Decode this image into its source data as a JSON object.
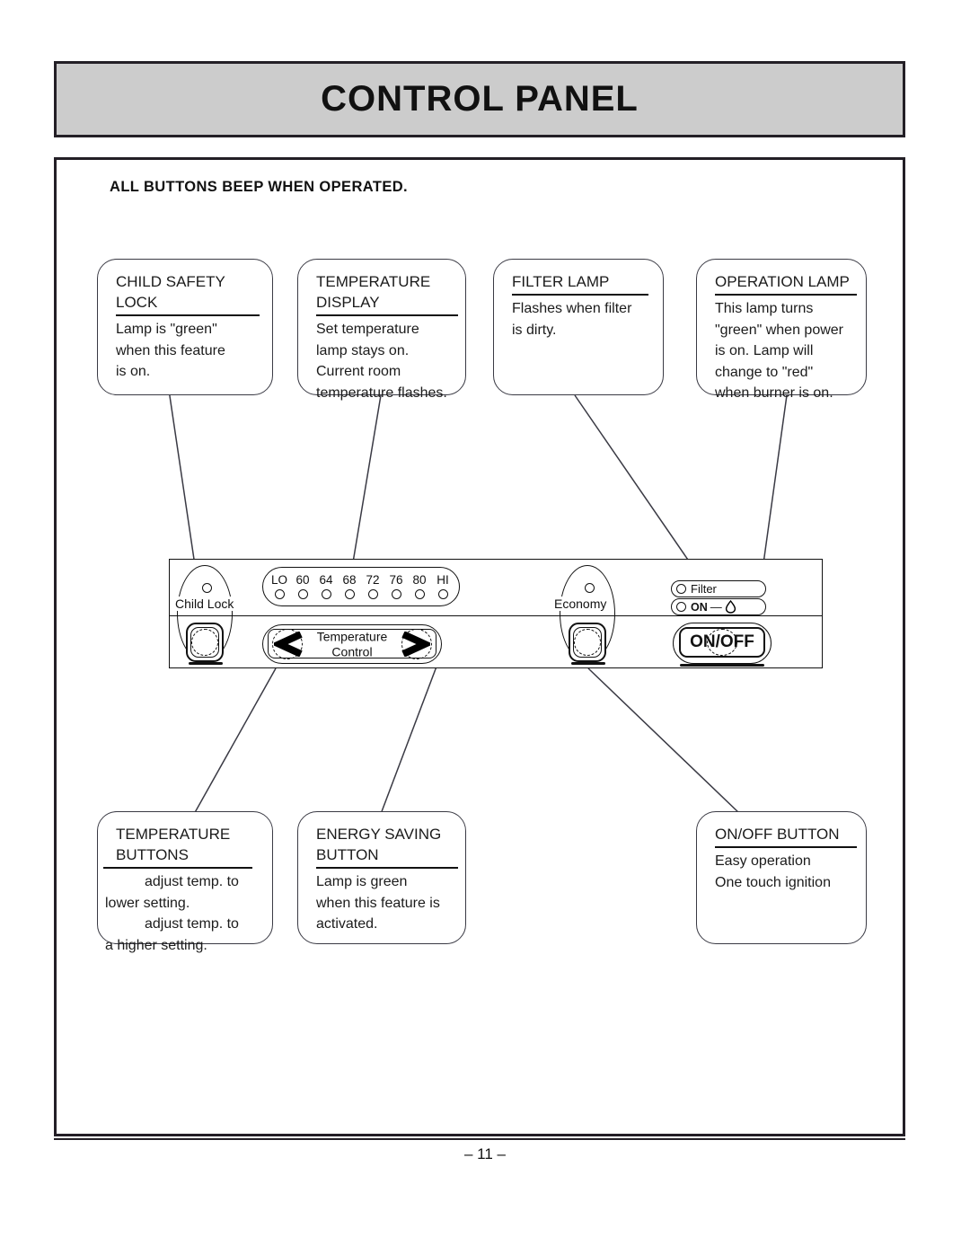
{
  "header": {
    "title": "CONTROL PANEL"
  },
  "notice": "ALL BUTTONS BEEP WHEN OPERATED.",
  "callouts": {
    "child_safety_lock": {
      "title_line1": "CHILD SAFETY",
      "title_line2": "LOCK",
      "body": [
        "Lamp is \"green\"",
        "when this feature",
        "is on."
      ]
    },
    "temperature_display": {
      "title_line1": "TEMPERATURE",
      "title_line2": "DISPLAY",
      "body": [
        "Set temperature",
        "lamp stays on.",
        "Current room",
        "temperature flashes."
      ]
    },
    "filter_lamp": {
      "title_line1": "FILTER LAMP",
      "body": [
        "Flashes when filter",
        "is dirty."
      ]
    },
    "operation_lamp": {
      "title_line1": "OPERATION LAMP",
      "body": [
        "This lamp turns",
        "\"green\" when power",
        "is on.  Lamp will",
        "change to \"red\"",
        "when burner is on."
      ]
    },
    "temperature_buttons": {
      "title_line1": "TEMPERATURE",
      "title_line2": "BUTTONS",
      "body": [
        "adjust temp. to",
        "lower setting.",
        "adjust temp. to",
        "a higher setting."
      ]
    },
    "energy_saving_button": {
      "title_line1": "ENERGY SAVING",
      "title_line2": "BUTTON",
      "body": [
        "Lamp is  green",
        "when this feature is",
        "activated."
      ]
    },
    "onoff_button": {
      "title_line1": "ON/OFF BUTTON",
      "body": [
        "Easy operation",
        "One touch ignition"
      ]
    }
  },
  "panel": {
    "child_lock_label": "Child Lock",
    "economy_label": "Economy",
    "temperature_scale": [
      "LO",
      "60",
      "64",
      "68",
      "72",
      "76",
      "80",
      "HI"
    ],
    "temperature_control_line1": "Temperature",
    "temperature_control_line2": "Control",
    "filter_indicator_label": "Filter",
    "on_indicator_label": "ON",
    "on_indicator_dash": "—",
    "onoff_button_label": "ON/OFF"
  },
  "footer": {
    "page_number": "– 11 –"
  },
  "colors": {
    "banner_fill": "#cccccc",
    "border": "#231f26",
    "ink": "#111111"
  }
}
